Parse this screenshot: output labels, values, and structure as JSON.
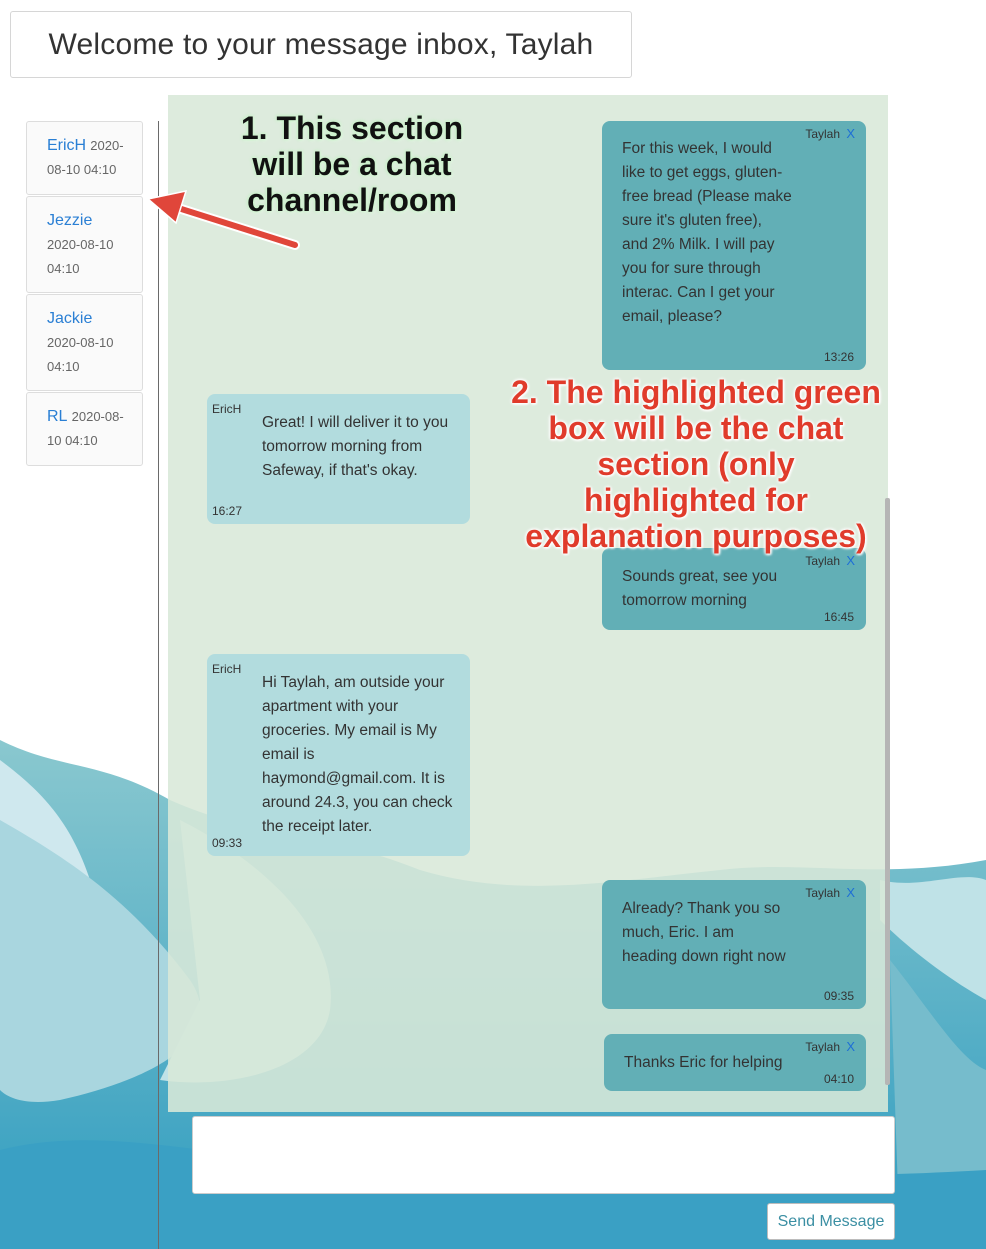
{
  "header": {
    "title": "Welcome to your message inbox, Taylah"
  },
  "rooms": [
    {
      "name": "EricH",
      "time": "2020-08-10 04:10"
    },
    {
      "name": "Jezzie",
      "time": "2020-08-10 04:10"
    },
    {
      "name": "Jackie",
      "time": "2020-08-10 04:10"
    },
    {
      "name": "RL",
      "time": "2020-08-10 04:10"
    }
  ],
  "messages": [
    {
      "sender": "Taylah",
      "delete": "X",
      "text": "For this week, I would like to get eggs, gluten-free bread (Please make sure it's gluten free), and 2% Milk. I will pay you for sure through interac. Can I get your email, please?",
      "time": "13:26"
    },
    {
      "sender": "EricH",
      "text": "Great! I will deliver it to you tomorrow morning from Safeway, if that's okay.",
      "time": "16:27"
    },
    {
      "sender": "Taylah",
      "delete": "X",
      "text": "Sounds great, see you tomorrow morning",
      "time": "16:45"
    },
    {
      "sender": "EricH",
      "text": "Hi Taylah, am outside your apartment with your groceries. My email is My email is haymond@gmail.com. It is around 24.3, you can check the receipt later.",
      "time": "09:33"
    },
    {
      "sender": "Taylah",
      "delete": "X",
      "text": "Already? Thank you so much, Eric. I am heading down right now",
      "time": "09:35"
    },
    {
      "sender": "Taylah",
      "delete": "X",
      "text": "Thanks Eric for helping",
      "time": "04:10"
    }
  ],
  "annotations": {
    "one": "1. This section will be a chat channel/room",
    "two": "2. The highlighted green box will be the chat section (only highlighted for explanation purposes)"
  },
  "composer": {
    "value": "",
    "send_label": "Send Message"
  },
  "colors": {
    "own_bubble": "#62afb6",
    "other_bubble": "#b2dcde",
    "chat_highlight": "#d8e8d8",
    "link": "#2a7fd4",
    "annotation_red": "#e03b2b"
  }
}
